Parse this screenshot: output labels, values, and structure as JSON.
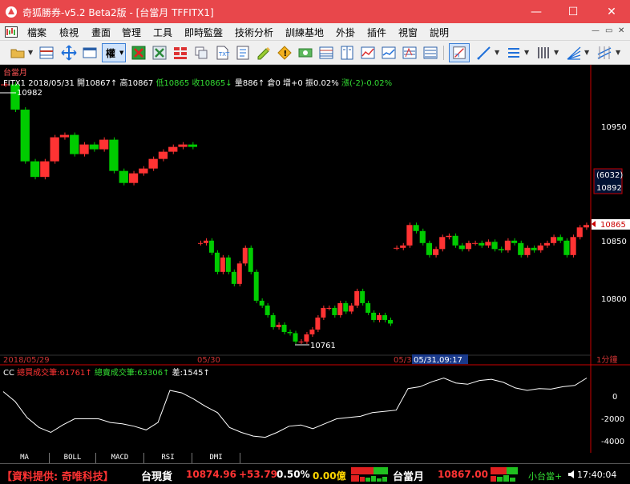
{
  "window": {
    "title": "奇狐勝券-v5.2 Beta2版 - [台當月 TFFITX1]",
    "minimize": "—",
    "maximize": "☐",
    "close": "✕"
  },
  "menu": {
    "items": [
      "檔案",
      "檢視",
      "畫面",
      "管理",
      "工具",
      "即時監盤",
      "技術分析",
      "訓練基地",
      "外掛",
      "插件",
      "視窗",
      "說明"
    ],
    "mdi_min": "—",
    "mdi_restore": "▭",
    "mdi_close": "✕"
  },
  "toolbar": {
    "rights_label": "權",
    "icons": [
      "open-folder-icon",
      "grid-icon",
      "crosshair-icon",
      "panel-icon",
      "rights-button",
      "red-mark-icon",
      "green-mark-icon",
      "layout-icon",
      "copy-icon",
      "file-icon",
      "notes-icon",
      "pencil-icon",
      "alert-icon",
      "money-icon",
      "table-icon",
      "book-icon",
      "line-chart-icon",
      "bar-chart-icon",
      "zoom-icon",
      "draw-tool-icon",
      "trend-line-icon",
      "text-lines-icon",
      "bars-icon",
      "fan-icon",
      "parallel-lines-icon"
    ]
  },
  "chart": {
    "symbol_name": "台當月",
    "quote_line": {
      "symbol": "FITX1",
      "date": "2018/05/31",
      "open": "開10867↑",
      "high": "高10867",
      "low": "低10865",
      "close": "收10865↓",
      "volume": "量886↑",
      "oi": "倉0",
      "oi_change": "增+0",
      "amplitude": "振0.02%",
      "change": "漲(-2)-0.02%"
    },
    "price_axis": [
      "10950",
      "10850",
      "10800"
    ],
    "oi_box": "(6032)",
    "price_box": "10892",
    "last_price": "10865",
    "high_marker": "10982",
    "low_marker": "10761",
    "time_labels": [
      "2018/05/29",
      "05/30",
      "05/3"
    ],
    "cursor_time": "05/31,09:17",
    "period": "1分鐘",
    "price_upper_ylim": [
      10760,
      10985
    ],
    "price_lower_ylim": [
      10760,
      10985
    ]
  },
  "indicator": {
    "label_cc": "CC",
    "buy_label": "總買成交筆:61761↑",
    "sell_label": "總賣成交筆:63306↑",
    "diff_label": "差:1545↑",
    "axis": [
      "0",
      "-2000",
      "-4000"
    ],
    "ylim": [
      -4600,
      1100
    ]
  },
  "tabs": [
    "MA",
    "BOLL",
    "MACD",
    "RSI",
    "DMI"
  ],
  "status": {
    "provider": "【資料提供: 奇唯科技】",
    "spot_name": "台現貨",
    "spot_price": "10874.96",
    "spot_change": "+53.79",
    "spot_pct": "0.50%",
    "spot_volume": "0.00億",
    "futures_name": "台當月",
    "futures_price": "10867.00",
    "mini_name": "小台當+",
    "time": "17:40:04"
  },
  "colors": {
    "title_bar": "#e8474b",
    "up": "#ff3333",
    "down": "#00cc00",
    "axis_text": "#ffffff",
    "panel_border": "#cc0000",
    "quote_green": "#33dd33",
    "status_yellow": "#ffd700"
  },
  "chart_data": {
    "type": "line",
    "title": "台當月",
    "ylabel": "",
    "xlabel": "",
    "categories": [
      "2018/05/29",
      "05/30",
      "05/31"
    ],
    "series": [
      {
        "name": "FITX1",
        "values": [
          10982,
          10961,
          10918,
          10905,
          10918,
          10938,
          10940,
          10924,
          10932,
          10928,
          10936,
          10910,
          10900,
          10908,
          10912,
          10920,
          10926,
          10930,
          10932,
          10930
        ]
      },
      {
        "name": "FITX1",
        "values": [
          10850,
          10852,
          10842,
          10826,
          10838,
          10826,
          10816,
          10833,
          10846,
          10826,
          10802,
          10798,
          10790,
          10780,
          10782,
          10776,
          10775,
          10768,
          10768,
          10774,
          10778,
          10788,
          10796,
          10796,
          10790,
          10800,
          10793,
          10798,
          10810,
          10800,
          10792,
          10786,
          10790,
          10786,
          10783
        ]
      },
      {
        "name": "FITX1",
        "values": [
          10846,
          10848,
          10865,
          10860,
          10850,
          10840,
          10845,
          10855,
          10856,
          10848,
          10845,
          10850,
          10850,
          10848,
          10851,
          10845,
          10844,
          10852,
          10850,
          10840,
          10846,
          10844,
          10848,
          10850,
          10855,
          10852,
          10840,
          10855,
          10863,
          10865
        ]
      }
    ],
    "ylim": [
      10760,
      10985
    ],
    "indicator": {
      "name": "CC",
      "values": [
        -100,
        -900,
        -2200,
        -3000,
        -3400,
        -2800,
        -2300,
        -2300,
        -2300,
        -2600,
        -2700,
        -2900,
        -3200,
        -2600,
        0,
        -200,
        -700,
        -1300,
        -1800,
        -3000,
        -3400,
        -3700,
        -3800,
        -3400,
        -2900,
        -2800,
        -3100,
        -2700,
        -2300,
        -2200,
        -2100,
        -1800,
        -1700,
        -1600,
        150,
        300,
        700,
        1000,
        600,
        500,
        800,
        900,
        650,
        200,
        0,
        150,
        100,
        300,
        400,
        1000
      ],
      "ylim": [
        -4600,
        1100
      ]
    }
  }
}
